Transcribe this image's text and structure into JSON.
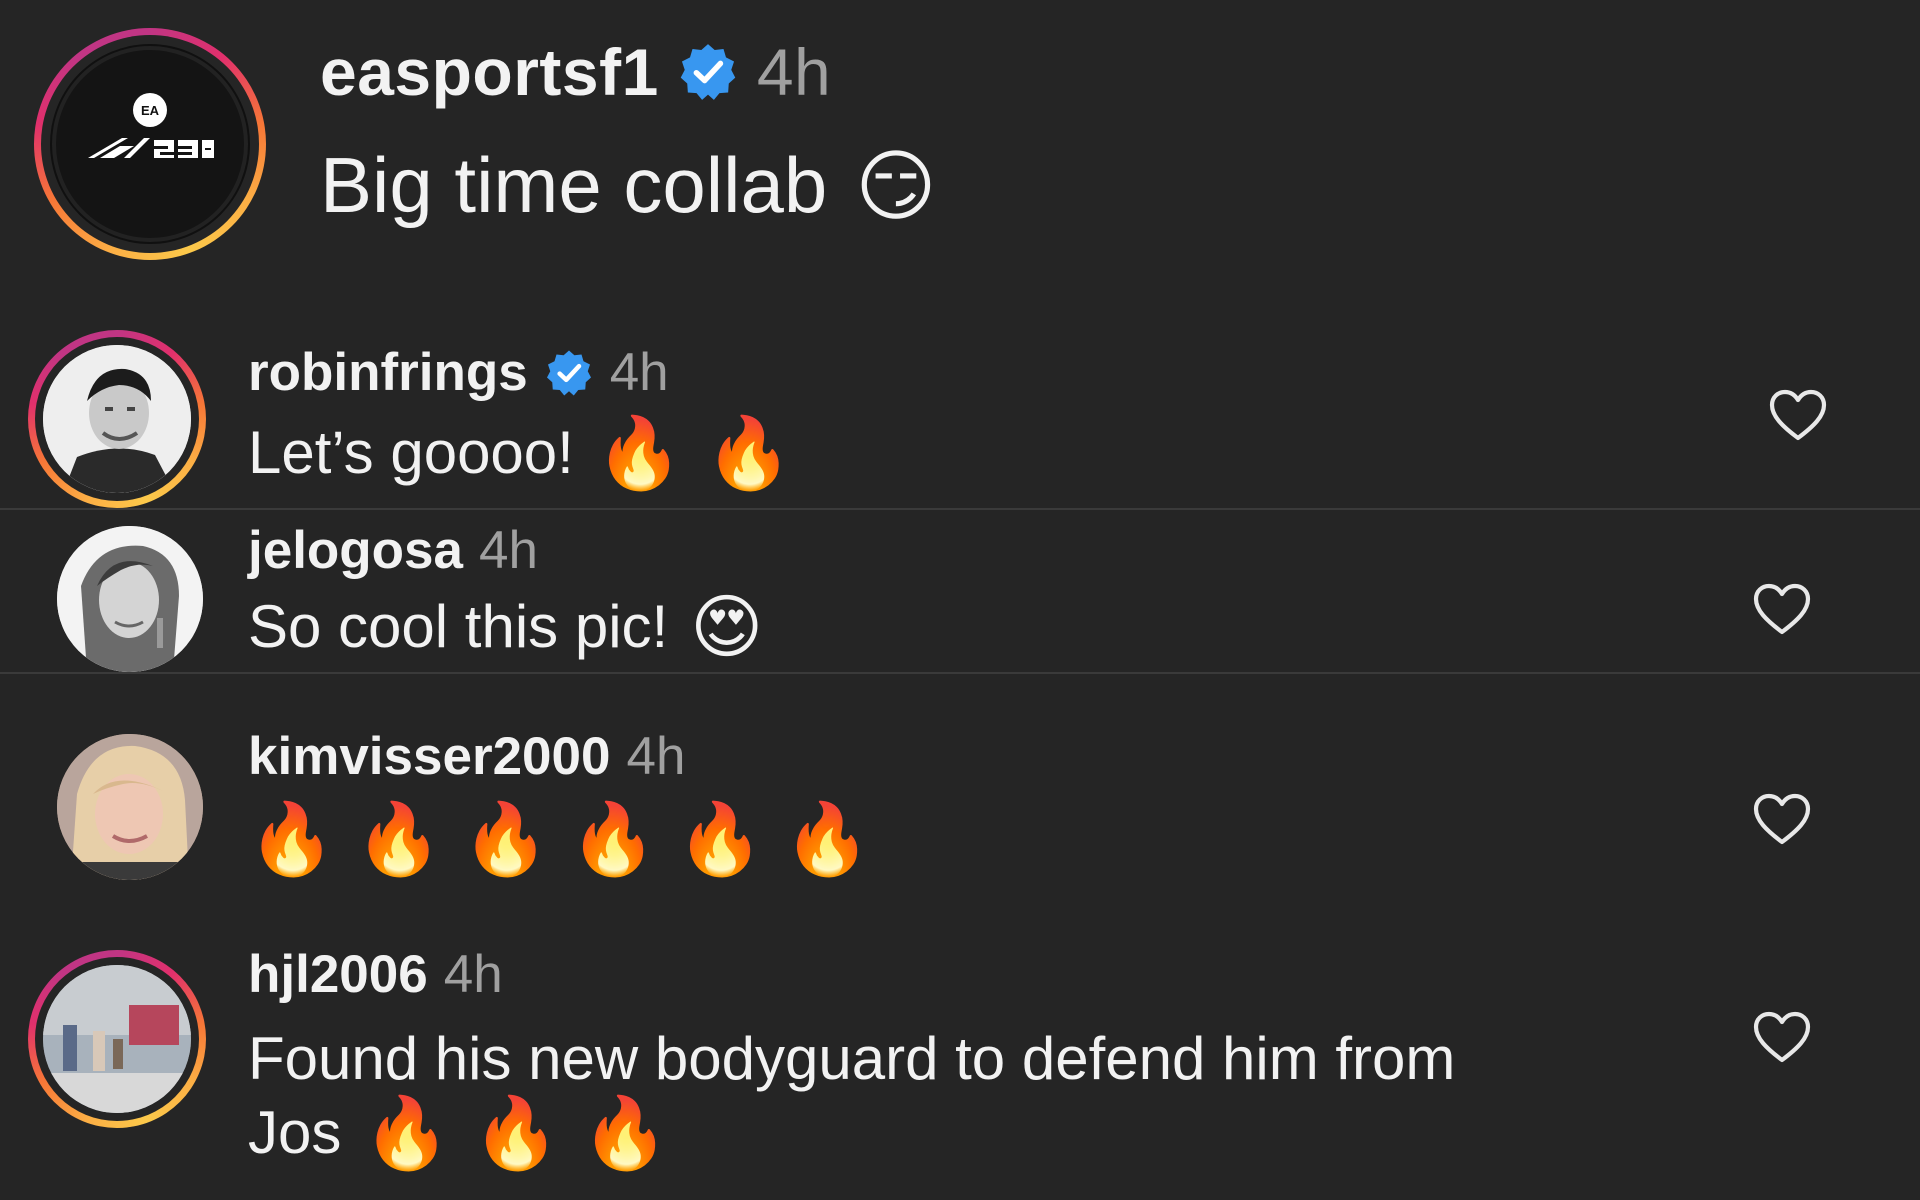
{
  "caption": {
    "username": "easportsf1",
    "time": "4h",
    "text": "Big time collab",
    "emoji": "😏",
    "logo_text": "F1 23",
    "logo_badge": "EA"
  },
  "comments": [
    {
      "username": "robinfrings",
      "verified": true,
      "time": "4h",
      "text": "Let’s goooo!",
      "emojis": [
        "🔥",
        "🔥"
      ]
    },
    {
      "username": "jelogosa",
      "verified": false,
      "time": "4h",
      "text": "So cool this pic!",
      "emojis": [
        "😍"
      ]
    },
    {
      "username": "kimvisser2000",
      "verified": false,
      "time": "4h",
      "text": "",
      "emojis": [
        "🔥",
        "🔥",
        "🔥",
        "🔥",
        "🔥",
        "🔥"
      ]
    },
    {
      "username": "hjl2006",
      "verified": false,
      "time": "4h",
      "text_line1": "Found his new bodyguard to defend him from",
      "text_line2": "Jos",
      "emojis": [
        "🔥",
        "🔥",
        "🔥"
      ]
    }
  ],
  "icons": {
    "verified": "verified-badge-icon",
    "like": "heart-icon"
  },
  "colors": {
    "background": "#252525",
    "text": "#f2f2f2",
    "muted": "#a0a0a0",
    "verified": "#3897f0"
  }
}
